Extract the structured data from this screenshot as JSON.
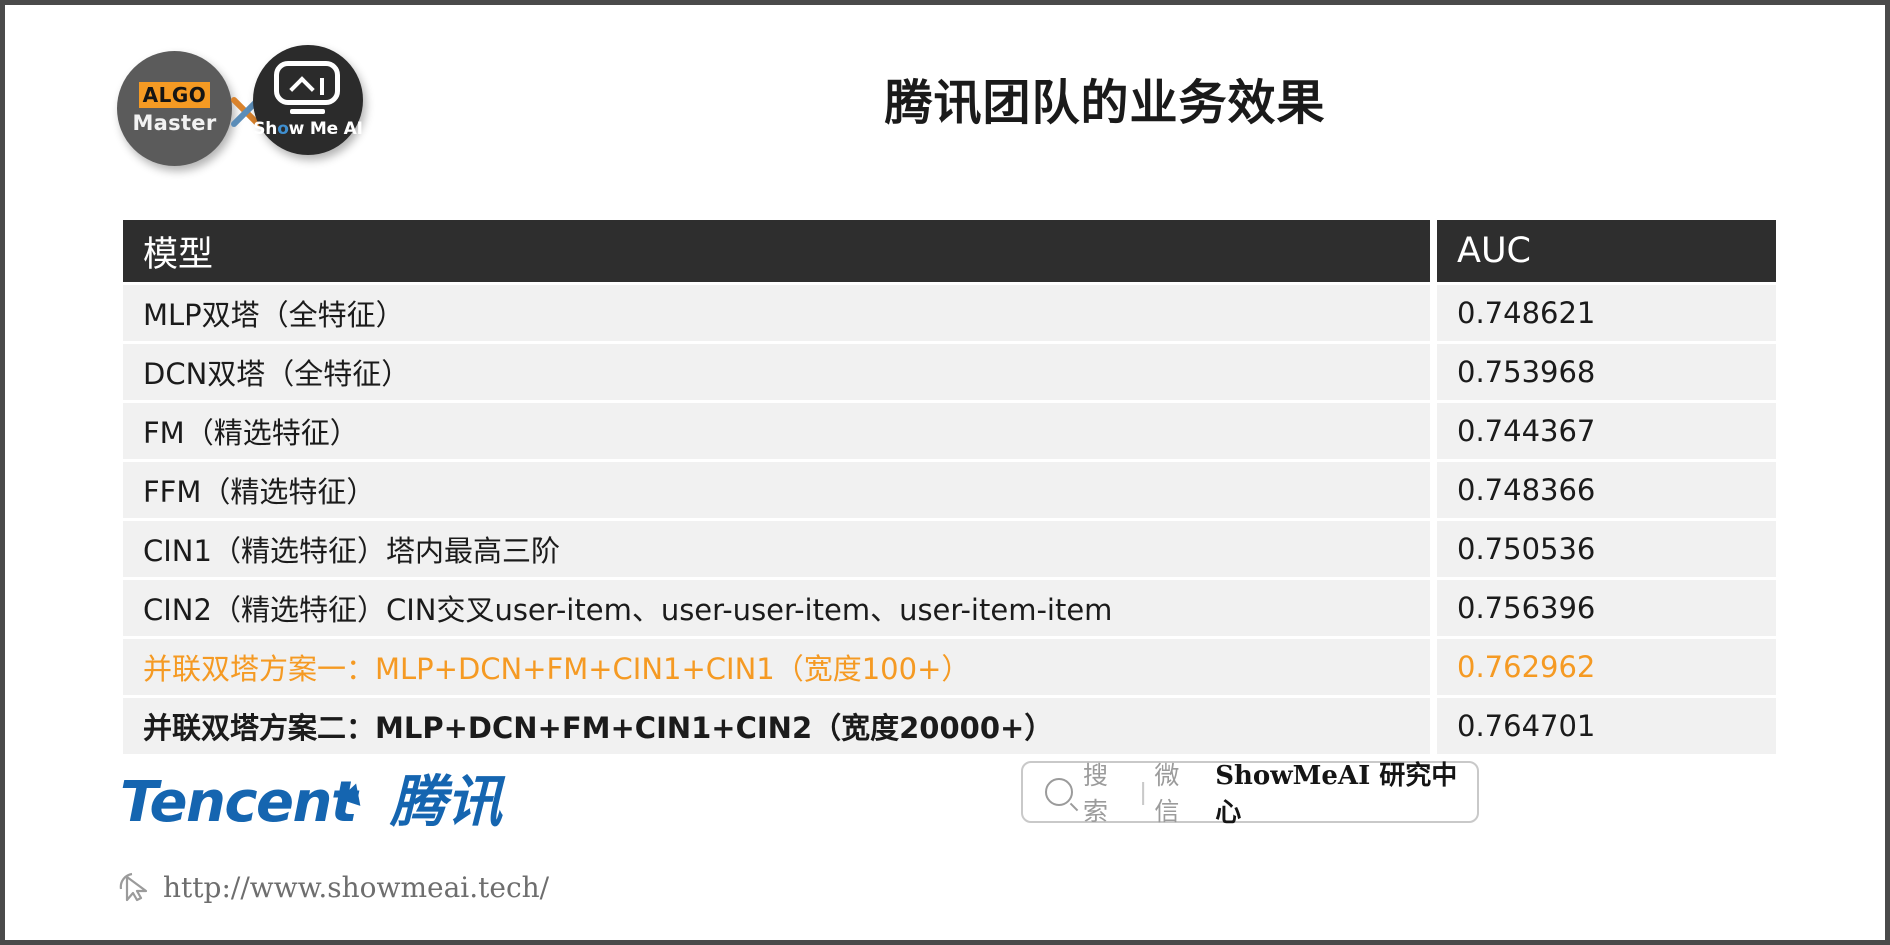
{
  "slide": {
    "title": "腾讯团队的业务效果",
    "border_color": "#4a4a4a",
    "accent_color": "#f59a23",
    "header_bg": "#2e2e2e",
    "row_bg": "#f1f1f1"
  },
  "logos": {
    "algo": {
      "badge": "ALGO",
      "name": "Master"
    },
    "cross": "x",
    "showmeai": {
      "name_pre": "Sh",
      "name_eye": "o",
      "name_post": "w Me AI"
    }
  },
  "table": {
    "headers": {
      "model": "模型",
      "auc": "AUC"
    },
    "rows": [
      {
        "model": "MLP双塔（全特征）",
        "auc": "0.748621",
        "highlight": false,
        "bold": false
      },
      {
        "model": "DCN双塔（全特征）",
        "auc": "0.753968",
        "highlight": false,
        "bold": false
      },
      {
        "model": "FM（精选特征）",
        "auc": "0.744367",
        "highlight": false,
        "bold": false
      },
      {
        "model": "FFM（精选特征）",
        "auc": "0.748366",
        "highlight": false,
        "bold": false
      },
      {
        "model": "CIN1（精选特征）塔内最高三阶",
        "auc": "0.750536",
        "highlight": false,
        "bold": false
      },
      {
        "model": "CIN2（精选特征）CIN交叉user-item、user-user-item、user-item-item",
        "auc": "0.756396",
        "highlight": false,
        "bold": false
      },
      {
        "model": "并联双塔方案一：MLP+DCN+FM+CIN1+CIN1（宽度100+）",
        "auc": "0.762962",
        "highlight": true,
        "bold": false
      },
      {
        "model": "并联双塔方案二：MLP+DCN+FM+CIN1+CIN2（宽度20000+）",
        "auc": "0.764701",
        "highlight": false,
        "bold": true
      }
    ]
  },
  "footer": {
    "tencent_en": "Tencent",
    "tencent_cn": "腾讯",
    "search": {
      "placeholder": "搜索",
      "separator": "|",
      "channel": "微信",
      "brand": "ShowMeAI 研究中心"
    },
    "url": "http://www.showmeai.tech/"
  }
}
